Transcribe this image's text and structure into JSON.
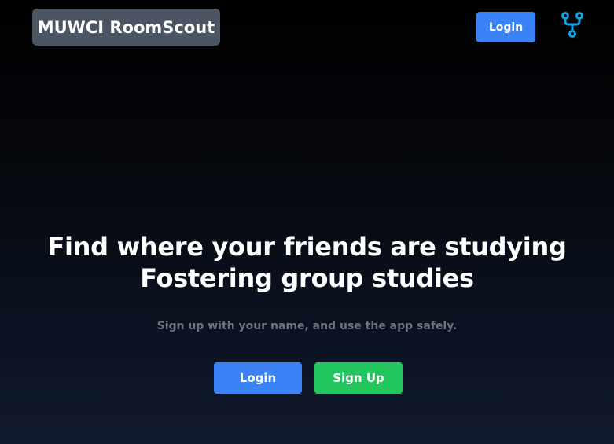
{
  "header": {
    "brand": "MUWCI RoomScout",
    "login_label": "Login",
    "repo_icon": "fork-icon"
  },
  "hero": {
    "title_line1": "Find where your friends are studying",
    "title_line2": "Fostering group studies",
    "subtitle": "Sign up with your name, and use the app safely.",
    "login_label": "Login",
    "signup_label": "Sign Up"
  },
  "colors": {
    "brand_bg": "#4b5563",
    "primary": "#3b82f6",
    "success": "#22c55e",
    "icon": "#0ea5e9",
    "muted_text": "#6b7280"
  }
}
